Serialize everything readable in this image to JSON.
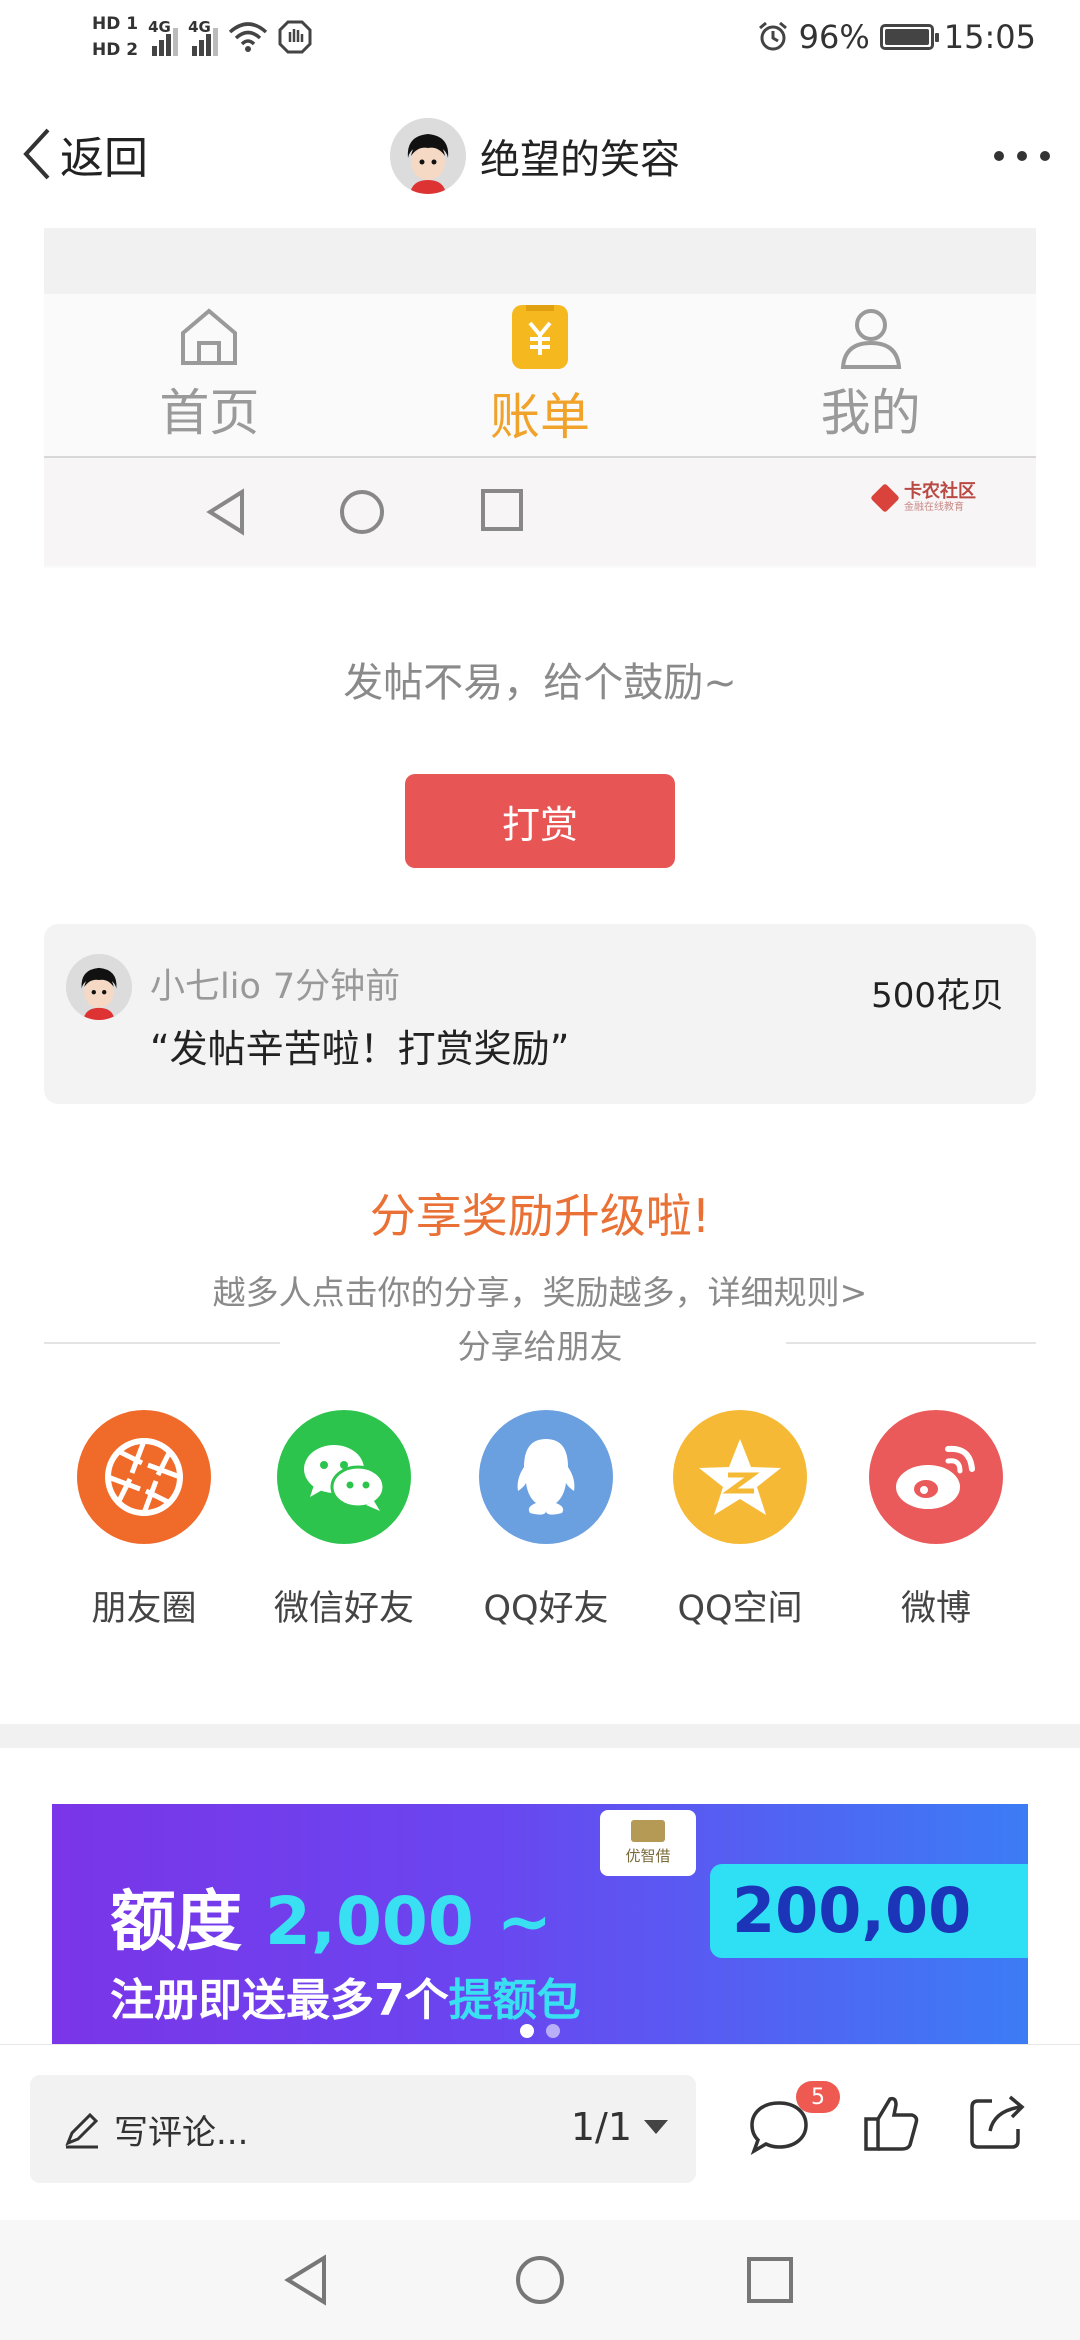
{
  "status_bar": {
    "sim1": "HD 1",
    "sim2": "HD 2",
    "network1": "4G",
    "network2": "4G",
    "battery": "96%",
    "time": "15:05"
  },
  "header": {
    "back_label": "返回",
    "title": "绝望的笑容"
  },
  "embedded_screenshot": {
    "tabs": [
      {
        "label": "首页",
        "icon": "home-icon",
        "active": false
      },
      {
        "label": "账单",
        "icon": "bill-icon",
        "active": true
      },
      {
        "label": "我的",
        "icon": "user-icon",
        "active": false
      }
    ],
    "watermark": {
      "name": "卡农社区",
      "tagline": "金融在线教育"
    }
  },
  "reward": {
    "prompt": "发帖不易，给个鼓励~",
    "button_label": "打赏",
    "entry": {
      "user": "小七lio",
      "time": "7分钟前",
      "amount": "500花贝",
      "message": "“发帖辛苦啦！打赏奖励”"
    }
  },
  "share": {
    "title": "分享奖励升级啦!",
    "subtitle": "越多人点击你的分享，奖励越多，详细规则>",
    "divider_label": "分享给朋友",
    "targets": [
      {
        "label": "朋友圈",
        "icon": "moments-icon",
        "color": "#f06a2a"
      },
      {
        "label": "微信好友",
        "icon": "wechat-icon",
        "color": "#2cc44c"
      },
      {
        "label": "QQ好友",
        "icon": "qq-icon",
        "color": "#6a9fe0"
      },
      {
        "label": "QQ空间",
        "icon": "qzone-icon",
        "color": "#f5b935"
      },
      {
        "label": "微博",
        "icon": "weibo-icon",
        "color": "#ea5a5a"
      }
    ]
  },
  "banner": {
    "logo_text": "优智借",
    "line1_prefix": "额度 ",
    "line1_amount": "2,000 ~",
    "line1_pill": "200,00",
    "line2_prefix": "注册即送最多7个",
    "line2_highlight": "提额包",
    "page_count": 2,
    "active_page": 1
  },
  "bottom_bar": {
    "comment_placeholder": "写评论...",
    "page_indicator": "1/1",
    "comment_badge": "5"
  },
  "colors": {
    "accent_orange": "#f0a22a",
    "reward_red": "#e85555",
    "share_title": "#ea7136",
    "badge_red": "#ee5a52"
  }
}
